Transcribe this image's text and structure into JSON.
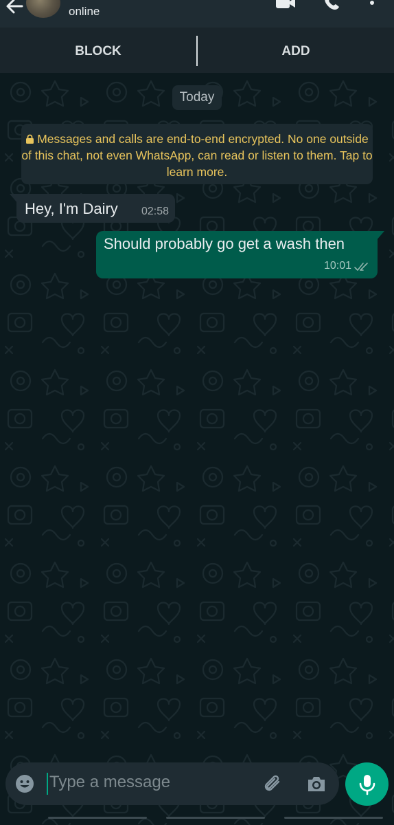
{
  "header": {
    "status": "online",
    "icons": [
      "back-arrow-icon",
      "contact-avatar",
      "video-call-icon",
      "voice-call-icon",
      "more-options-icon"
    ]
  },
  "actions": {
    "block_label": "BLOCK",
    "add_label": "ADD"
  },
  "chat": {
    "date_chip": "Today",
    "encryption_notice": "Messages and calls are end-to-end encrypted. No one outside of this chat, not even WhatsApp, can read or listen to them. Tap to learn more.",
    "messages": [
      {
        "direction": "incoming",
        "text": "Hey, I'm Dairy",
        "time": "02:58"
      },
      {
        "direction": "outgoing",
        "text": "Should probably go get a wash then",
        "time": "10:01",
        "status": "read"
      }
    ]
  },
  "composer": {
    "placeholder": "Type a message",
    "icons": [
      "emoji-icon",
      "attach-icon",
      "camera-icon",
      "mic-icon"
    ]
  },
  "colors": {
    "header_bg": "#1f2c33",
    "chat_bg": "#0c1a1e",
    "incoming_bubble": "#1f2c33",
    "outgoing_bubble": "#005c4b",
    "notice_text": "#e8c45c",
    "accent": "#00a884"
  }
}
